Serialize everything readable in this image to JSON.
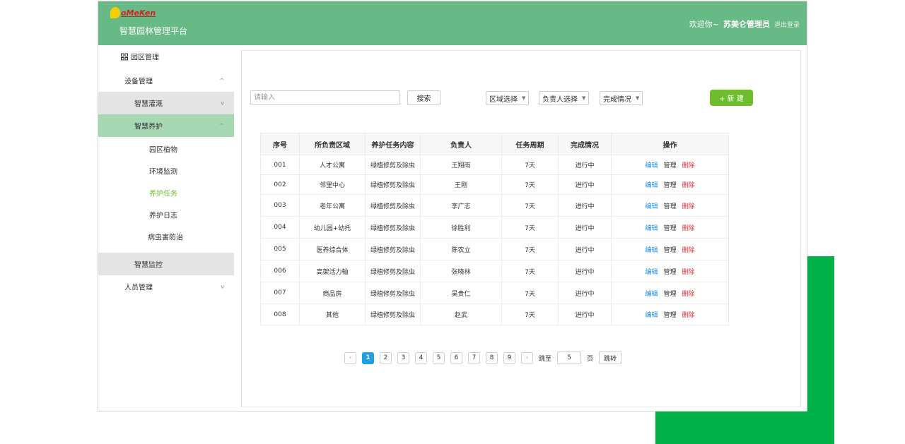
{
  "header": {
    "logo_text": "oMeKen",
    "title": "智慧园林管理平台",
    "welcome": "欢迎你~",
    "user": "苏美仑管理员",
    "logout": "退出登录",
    "bg_color": "#67b985"
  },
  "sidebar": {
    "park": "园区管理",
    "device": "设备管理",
    "irrigation": "智慧灌溉",
    "maintenance": "智慧养护",
    "sub": [
      "园区植物",
      "环境监测",
      "养护任务",
      "养护日志",
      "病虫害防治"
    ],
    "active_sub": "养护任务",
    "monitor": "智慧监控",
    "people": "人员管理"
  },
  "toolbar": {
    "search_placeholder": "请输入",
    "search_label": "搜索",
    "area_select": "区域选择",
    "owner_select": "负责人选择",
    "status_select": "完成情况",
    "new_label": "+ 新 建",
    "accent": "#6ebd2c"
  },
  "table": {
    "headers": [
      "序号",
      "所负责区域",
      "养护任务内容",
      "负责人",
      "任务周期",
      "完成情况",
      "操作"
    ],
    "rows": [
      [
        "001",
        "人才公寓",
        "绿植修剪及除虫",
        "王翔雨",
        "7天",
        "进行中"
      ],
      [
        "002",
        "邻里中心",
        "绿植修剪及除虫",
        "王刚",
        "7天",
        "进行中"
      ],
      [
        "003",
        "老年公寓",
        "绿植修剪及除虫",
        "李广志",
        "7天",
        "进行中"
      ],
      [
        "004",
        "幼儿园+幼托",
        "绿植修剪及除虫",
        "徐胜利",
        "7天",
        "进行中"
      ],
      [
        "005",
        "医养综合体",
        "绿植修剪及除虫",
        "陈农立",
        "7天",
        "进行中"
      ],
      [
        "006",
        "高架活力轴",
        "绿植修剪及除虫",
        "张晓林",
        "7天",
        "进行中"
      ],
      [
        "007",
        "商品房",
        "绿植修剪及除虫",
        "吴贵仁",
        "7天",
        "进行中"
      ],
      [
        "008",
        "其他",
        "绿植修剪及除虫",
        "赵武",
        "7天",
        "进行中"
      ]
    ],
    "ops": {
      "edit": "编辑",
      "manage": "管理",
      "delete": "删除"
    }
  },
  "pagination": {
    "prev": "‹",
    "next": "›",
    "pages": [
      "1",
      "2",
      "3",
      "4",
      "5",
      "6",
      "7",
      "8",
      "9"
    ],
    "current": "1",
    "jump_prefix": "跳至",
    "jump_value": "5",
    "jump_suffix": "页",
    "jump_button": "跳转"
  }
}
